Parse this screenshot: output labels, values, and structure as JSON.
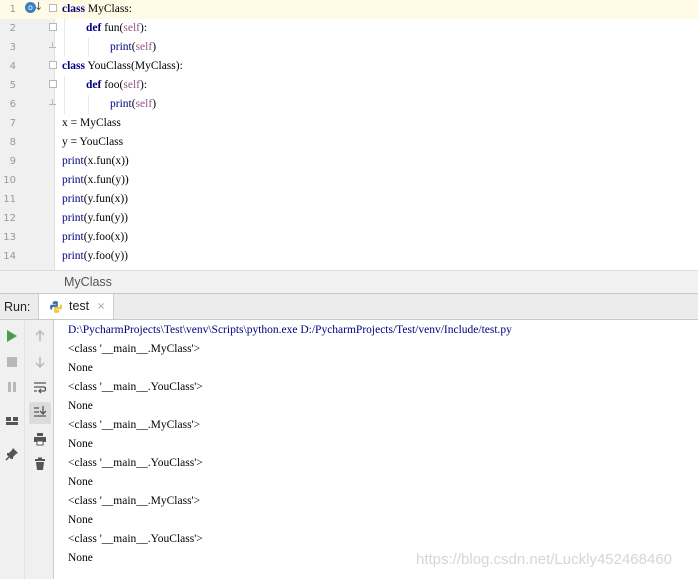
{
  "editor": {
    "lines": [
      {
        "num": "1",
        "indent": 0,
        "tokens": [
          {
            "t": "class",
            "c": "kw"
          },
          {
            "t": " MyClass:",
            "c": ""
          }
        ]
      },
      {
        "num": "2",
        "indent": 1,
        "tokens": [
          {
            "t": "def",
            "c": "kw"
          },
          {
            "t": " fun(",
            "c": ""
          },
          {
            "t": "self",
            "c": "self"
          },
          {
            "t": "):",
            "c": ""
          }
        ]
      },
      {
        "num": "3",
        "indent": 2,
        "tokens": [
          {
            "t": "print",
            "c": "bi"
          },
          {
            "t": "(",
            "c": ""
          },
          {
            "t": "self",
            "c": "self"
          },
          {
            "t": ")",
            "c": ""
          }
        ]
      },
      {
        "num": "4",
        "indent": 0,
        "tokens": [
          {
            "t": "class",
            "c": "kw"
          },
          {
            "t": " YouClass(MyClass):",
            "c": ""
          }
        ]
      },
      {
        "num": "5",
        "indent": 1,
        "tokens": [
          {
            "t": "def",
            "c": "kw"
          },
          {
            "t": " foo(",
            "c": ""
          },
          {
            "t": "self",
            "c": "self"
          },
          {
            "t": "):",
            "c": ""
          }
        ]
      },
      {
        "num": "6",
        "indent": 2,
        "tokens": [
          {
            "t": "print",
            "c": "bi"
          },
          {
            "t": "(",
            "c": ""
          },
          {
            "t": "self",
            "c": "self"
          },
          {
            "t": ")",
            "c": ""
          }
        ]
      },
      {
        "num": "7",
        "indent": 0,
        "tokens": [
          {
            "t": "x = MyClass",
            "c": ""
          }
        ]
      },
      {
        "num": "8",
        "indent": 0,
        "tokens": [
          {
            "t": "y = YouClass",
            "c": ""
          }
        ]
      },
      {
        "num": "9",
        "indent": 0,
        "tokens": [
          {
            "t": "print",
            "c": "bi"
          },
          {
            "t": "(x.fun(x))",
            "c": ""
          }
        ]
      },
      {
        "num": "10",
        "indent": 0,
        "tokens": [
          {
            "t": "print",
            "c": "bi"
          },
          {
            "t": "(x.fun(y))",
            "c": ""
          }
        ]
      },
      {
        "num": "11",
        "indent": 0,
        "tokens": [
          {
            "t": "print",
            "c": "bi"
          },
          {
            "t": "(y.fun(x))",
            "c": ""
          }
        ]
      },
      {
        "num": "12",
        "indent": 0,
        "tokens": [
          {
            "t": "print",
            "c": "bi"
          },
          {
            "t": "(y.fun(y))",
            "c": ""
          }
        ]
      },
      {
        "num": "13",
        "indent": 0,
        "tokens": [
          {
            "t": "print",
            "c": "bi"
          },
          {
            "t": "(y.foo(x))",
            "c": ""
          }
        ]
      },
      {
        "num": "14",
        "indent": 0,
        "tokens": [
          {
            "t": "print",
            "c": "bi"
          },
          {
            "t": "(y.foo(y))",
            "c": ""
          }
        ]
      }
    ]
  },
  "breadcrumb": {
    "label": "MyClass"
  },
  "run": {
    "label": "Run:",
    "tab_label": "test",
    "close_glyph": "×"
  },
  "console": {
    "lines": [
      {
        "text": "D:\\PycharmProjects\\Test\\venv\\Scripts\\python.exe D:/PycharmProjects/Test/venv/Include/test.py",
        "kind": "cmd"
      },
      {
        "text": "<class '__main__.MyClass'>",
        "kind": "out"
      },
      {
        "text": "None",
        "kind": "out"
      },
      {
        "text": "<class '__main__.YouClass'>",
        "kind": "out"
      },
      {
        "text": "None",
        "kind": "out"
      },
      {
        "text": "<class '__main__.MyClass'>",
        "kind": "out"
      },
      {
        "text": "None",
        "kind": "out"
      },
      {
        "text": "<class '__main__.YouClass'>",
        "kind": "out"
      },
      {
        "text": "None",
        "kind": "out"
      },
      {
        "text": "<class '__main__.MyClass'>",
        "kind": "out"
      },
      {
        "text": "None",
        "kind": "out"
      },
      {
        "text": "<class '__main__.YouClass'>",
        "kind": "out"
      },
      {
        "text": "None",
        "kind": "out"
      }
    ]
  },
  "watermark": {
    "text": "https://blog.csdn.net/Luckly452468460"
  },
  "icons": {
    "override_marker": "override-icon",
    "run": "run-icon",
    "stop": "stop-icon",
    "pause": "pause-icon",
    "rerun_up": "scroll-up-icon",
    "rerun_down": "scroll-down-icon",
    "soft_wrap": "soft-wrap-icon",
    "scroll_to_end": "scroll-to-end-icon",
    "print": "print-icon",
    "trash": "trash-icon",
    "layout": "layout-icon",
    "pin": "pin-icon"
  },
  "colors": {
    "keyword": "#000080",
    "self": "#94558d",
    "run_green": "#499c54",
    "current_line": "#fffbe6"
  }
}
